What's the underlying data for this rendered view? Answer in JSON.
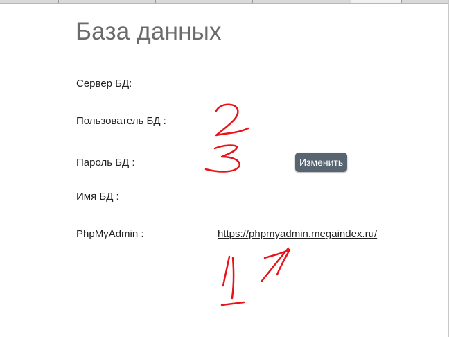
{
  "page": {
    "title": "База данных"
  },
  "rows": {
    "server_label": "Сервер БД:",
    "user_label": "Пользователь БД :",
    "password_label": "Пароль БД :",
    "dbname_label": "Имя БД :",
    "phpmyadmin_label": "PhpMyAdmin :"
  },
  "buttons": {
    "change_label": "Изменить"
  },
  "links": {
    "phpmyadmin_url": "https://phpmyadmin.megaindex.ru/"
  },
  "annotations": {
    "color": "#e8141b",
    "marks": [
      "1",
      "2",
      "3"
    ]
  },
  "colors": {
    "title": "#6b6b6b",
    "button_bg": "#596471",
    "button_text": "#ffffff"
  }
}
